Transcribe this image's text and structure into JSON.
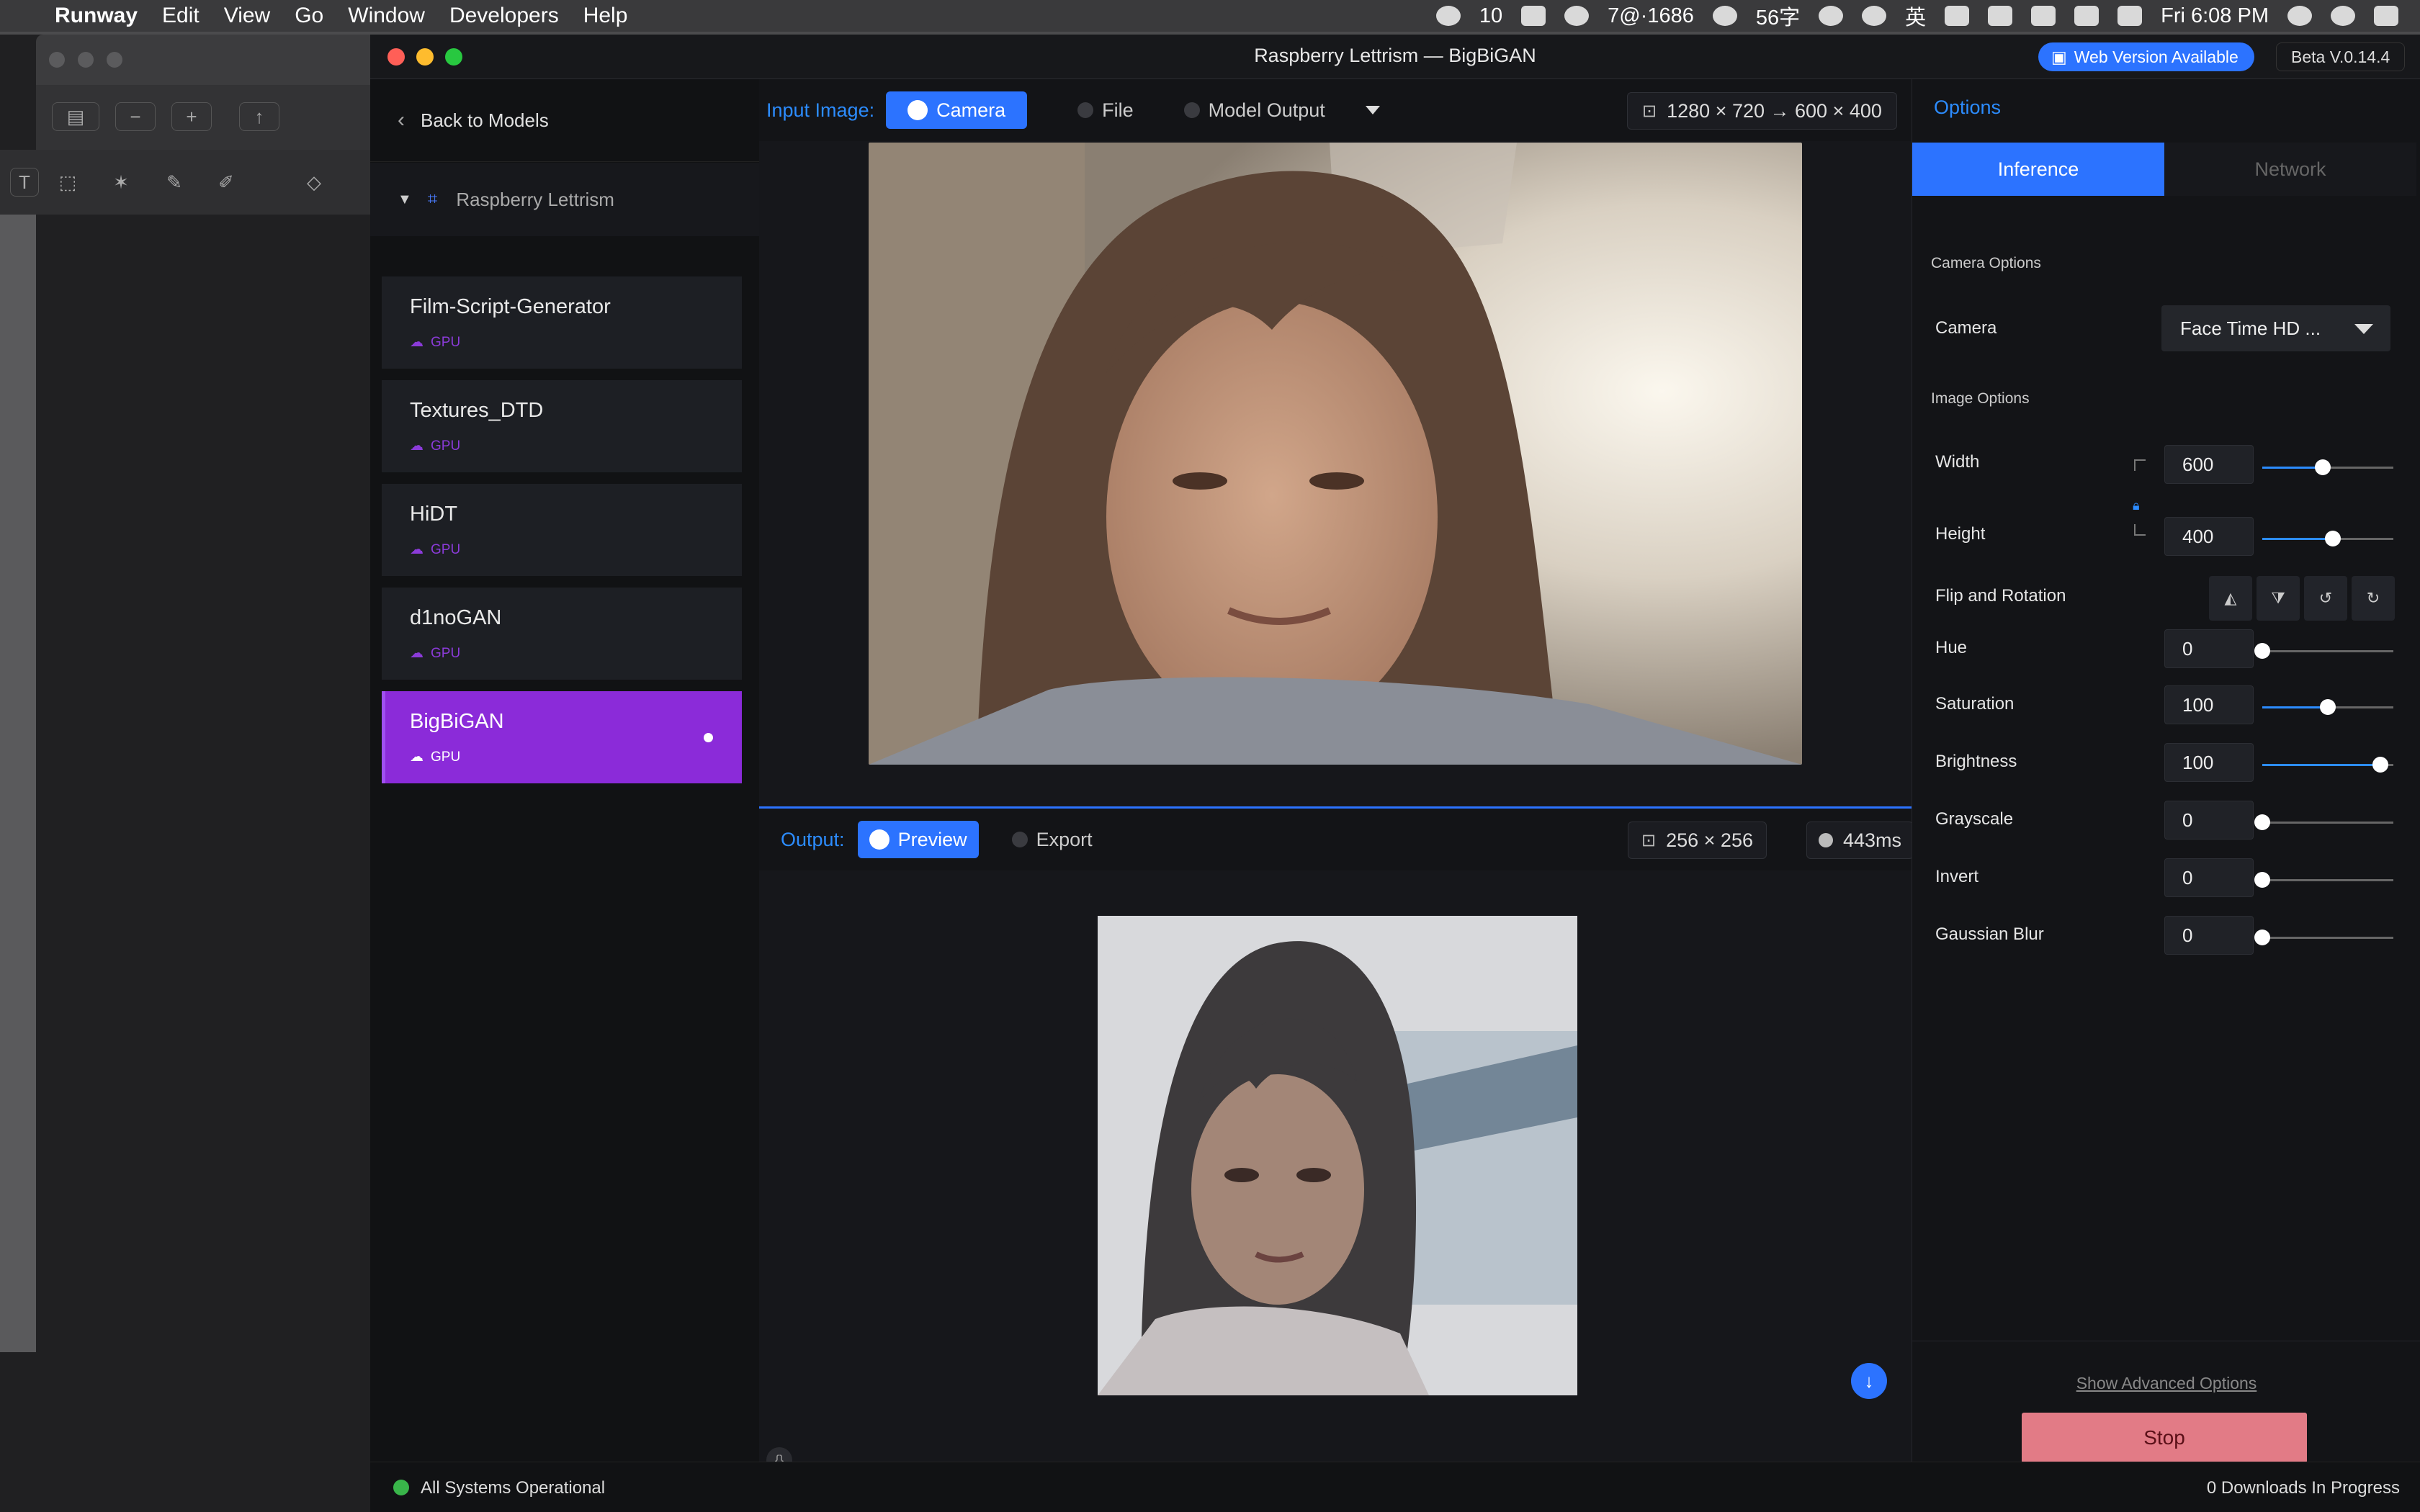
{
  "menubar": {
    "app": "Runway",
    "items": [
      "Edit",
      "View",
      "Go",
      "Window",
      "Developers",
      "Help"
    ],
    "wechat_count": "10",
    "signal_text": "7@·1686",
    "ime_text": "56字",
    "lang": "英",
    "clock": "Fri 6:08 PM"
  },
  "window": {
    "title": "Raspberry Lettrism — BigBiGAN",
    "web_version": "Web Version Available",
    "beta": "Beta V.0.14.4"
  },
  "sidebar": {
    "back": "Back to Models",
    "project": "Raspberry Lettrism",
    "models": [
      {
        "name": "Film-Script-Generator",
        "tag": "GPU"
      },
      {
        "name": "Textures_DTD",
        "tag": "GPU"
      },
      {
        "name": "HiDT",
        "tag": "GPU"
      },
      {
        "name": "d1noGAN",
        "tag": "GPU"
      },
      {
        "name": "BigBiGAN",
        "tag": "GPU"
      }
    ]
  },
  "input": {
    "label": "Input Image:",
    "camera": "Camera",
    "file": "File",
    "model_output": "Model Output",
    "resolution": "1280 × 720 → 600 × 400"
  },
  "output": {
    "label": "Output:",
    "preview": "Preview",
    "export": "Export",
    "size": "256 × 256",
    "latency": "443ms"
  },
  "options": {
    "title": "Options",
    "tabs": [
      "Inference",
      "Network"
    ],
    "camera_options": "Camera Options",
    "camera_label": "Camera",
    "camera_value": "Face Time HD ...",
    "image_options": "Image Options",
    "width_label": "Width",
    "width": "600",
    "height_label": "Height",
    "height": "400",
    "flip_label": "Flip and Rotation",
    "hue_label": "Hue",
    "hue": "0",
    "saturation_label": "Saturation",
    "saturation": "100",
    "brightness_label": "Brightness",
    "brightness": "100",
    "grayscale_label": "Grayscale",
    "grayscale": "0",
    "invert_label": "Invert",
    "invert": "0",
    "blur_label": "Gaussian Blur",
    "blur": "0",
    "sliders": {
      "width": 0.46,
      "height": 0.54,
      "hue": 0.0,
      "saturation": 0.5,
      "brightness": 0.9,
      "grayscale": 0.0,
      "invert": 0.0,
      "blur": 0.0
    },
    "advanced": "Show Advanced Options",
    "stop": "Stop"
  },
  "status": {
    "systems": "All Systems Operational",
    "downloads": "0 Downloads In Progress"
  },
  "colors": {
    "accent_blue": "#2c73ff",
    "active_purple": "#8b2bd9",
    "stop_red": "#e27b86",
    "status_green": "#39b54a"
  }
}
